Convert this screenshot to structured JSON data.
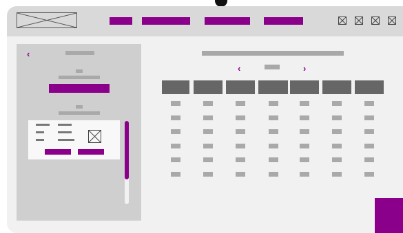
{
  "header": {
    "logo_icon": "image-placeholder-icon",
    "nav_items": [
      {
        "name": "nav-item-1"
      },
      {
        "name": "nav-item-2"
      },
      {
        "name": "nav-item-3"
      },
      {
        "name": "nav-item-4"
      }
    ],
    "window_controls": [
      "placeholder-icon",
      "placeholder-icon",
      "placeholder-icon",
      "placeholder-icon"
    ]
  },
  "sidebar": {
    "back_icon": "chevron-left-icon",
    "card_image_icon": "image-placeholder-icon"
  },
  "calendar": {
    "prev_icon": "chevron-left-icon",
    "next_icon": "chevron-right-icon",
    "columns": 7,
    "rows": 6
  },
  "colors": {
    "accent": "#8b008b",
    "header_bg": "#d9d9d9",
    "sidebar_bg": "#cfcfcf",
    "placeholder": "#a9a9a9",
    "grid_header": "#666666"
  }
}
